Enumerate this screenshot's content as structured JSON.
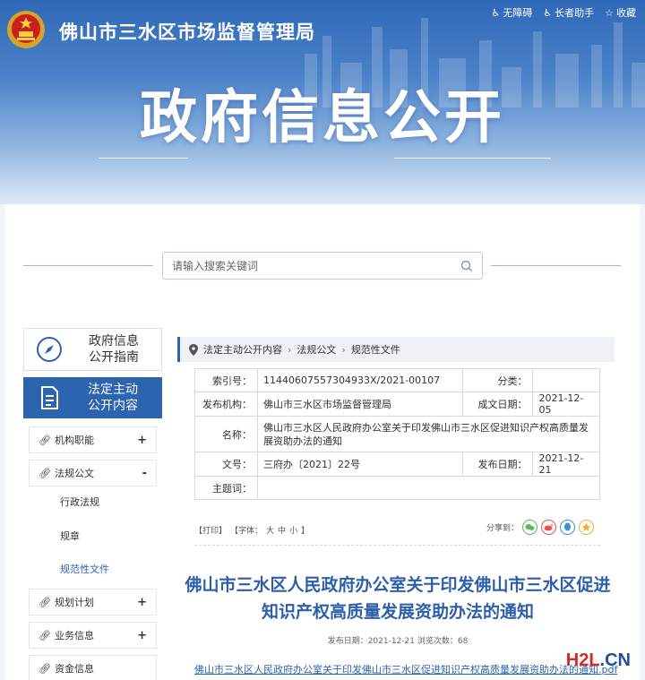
{
  "header": {
    "site_title": "佛山市三水区市场监督管理局",
    "section_title": "政府信息公开",
    "links": [
      "无障碍",
      "长者助手",
      "收藏"
    ]
  },
  "search": {
    "placeholder": "请输入搜索关键词"
  },
  "sidebar": {
    "guide_line1": "政府信息",
    "guide_line2": "公开指南",
    "active_line1": "法定主动",
    "active_line2": "公开内容",
    "categories": [
      {
        "label": "机构职能",
        "toggle": "+"
      },
      {
        "label": "法规公文",
        "toggle": "-"
      },
      {
        "label": "规划计划",
        "toggle": "+"
      },
      {
        "label": "业务信息",
        "toggle": "+"
      },
      {
        "label": "资金信息",
        "toggle": ""
      }
    ],
    "subitems": [
      "行政法规",
      "规章",
      "规范性文件"
    ]
  },
  "breadcrumb": [
    "法定主动公开内容",
    "法规公文",
    "规范性文件"
  ],
  "meta": {
    "index_label": "索引号：",
    "index_value": "11440607557304933X/2021-00107",
    "category_label": "分类：",
    "category_value": "",
    "publisher_label": "发布机构：",
    "publisher_value": "佛山市三水区市场监督管理局",
    "created_label": "成文日期：",
    "created_value": "2021-12-05",
    "name_label": "名称：",
    "name_value": "佛山市三水区人民政府办公室关于印发佛山市三水区促进知识产权高质量发展资助办法的通知",
    "docno_label": "文号：",
    "docno_value": "三府办〔2021〕22号",
    "pubdate_label": "发布日期：",
    "pubdate_value": "2021-12-21",
    "subject_label": "主题词：",
    "subject_value": ""
  },
  "toolbar": {
    "print": "【打印】",
    "font_open": "【字体：",
    "font_large": "大",
    "font_medium": "中",
    "font_small": "小",
    "font_close": "】",
    "share_label": "分享到："
  },
  "article": {
    "title": "佛山市三水区人民政府办公室关于印发佛山市三水区促进知识产权高质量发展资助办法的通知",
    "info": "发布日期：2021-12-21  浏览次数：68",
    "attachment": "佛山市三水区人民政府办公室关于印发佛山市三水区促进知识产权高质量发展资助办法的通知.pdf"
  },
  "watermark": {
    "part1": "H2L",
    "part2": ".CN"
  }
}
